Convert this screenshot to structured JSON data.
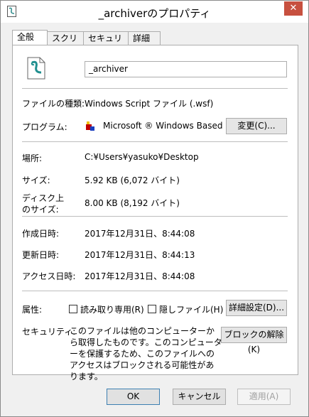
{
  "window": {
    "title": "_archiverのプロパティ",
    "close_glyph": "✕"
  },
  "tabs": [
    {
      "label": "全般",
      "active": true
    },
    {
      "label": "スクリプト",
      "active": false
    },
    {
      "label": "セキュリティ",
      "active": false
    },
    {
      "label": "詳細",
      "active": false
    }
  ],
  "general": {
    "file_name": "_archiver",
    "file_type_label": "ファイルの種類:",
    "file_type_value": "Windows Script ファイル (.wsf)",
    "program_label": "プログラム:",
    "program_value": "Microsoft ® Windows Based",
    "change_button": "変更(C)...",
    "location_label": "場所:",
    "location_value": "C:¥Users¥yasuko¥Desktop",
    "size_label": "サイズ:",
    "size_value": "5.92 KB (6,072 バイト)",
    "disk_size_label_1": "ディスク上",
    "disk_size_label_2": "のサイズ:",
    "disk_size_value": "8.00 KB (8,192 バイト)",
    "created_label": "作成日時:",
    "created_value": "2017年12月31日、8:44:08",
    "modified_label": "更新日時:",
    "modified_value": "2017年12月31日、8:44:13",
    "accessed_label": "アクセス日時:",
    "accessed_value": "2017年12月31日、8:44:08",
    "attributes_label": "属性:",
    "readonly_label": "読み取り専用(R)",
    "hidden_label": "隠しファイル(H)",
    "advanced_button": "詳細設定(D)...",
    "security_label": "セキュリティ:",
    "security_text": "このファイルは他のコンピューターから取得したものです。このコンピューターを保護するため、このファイルへのアクセスはブロックされる可能性があります。",
    "unblock_button": "ブロックの解除(K)"
  },
  "buttons": {
    "ok": "OK",
    "cancel": "キャンセル",
    "apply": "適用(A)"
  },
  "colors": {
    "close_button": "#c7503f",
    "window_bg": "#f0f0f0"
  }
}
